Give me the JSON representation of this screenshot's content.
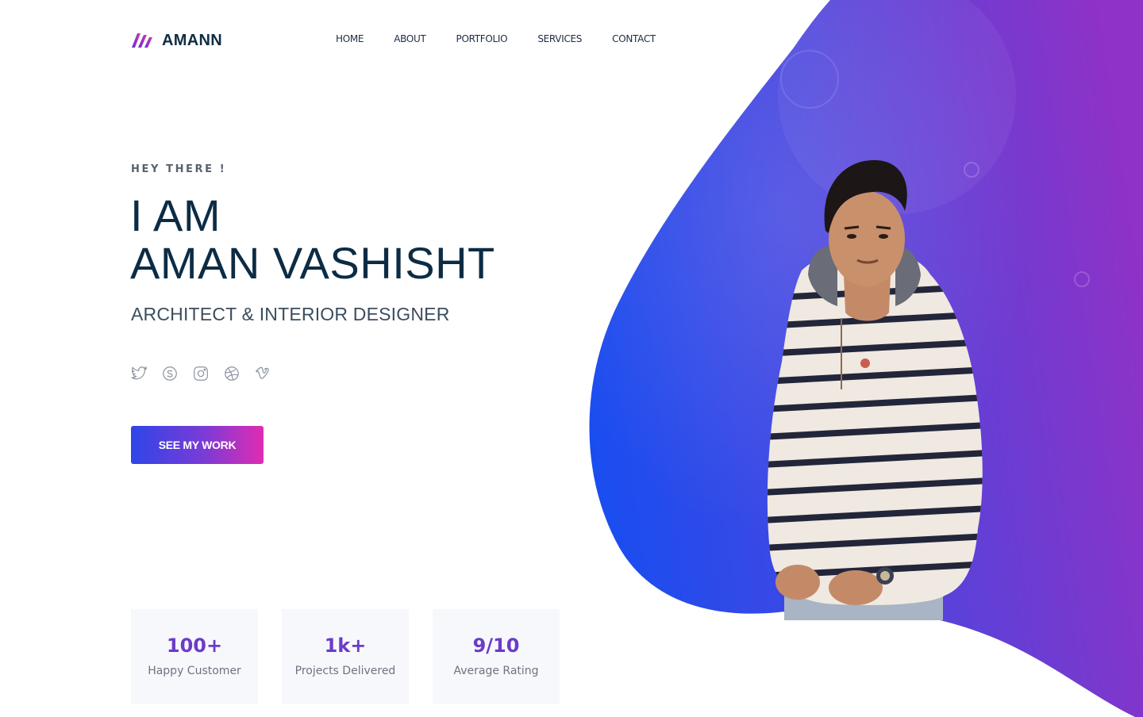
{
  "brand": {
    "name": "AMANN",
    "gradient": [
      "#5b2fe3",
      "#e3359f"
    ]
  },
  "nav": [
    {
      "label": "HOME"
    },
    {
      "label": "ABOUT"
    },
    {
      "label": "PORTFOLIO"
    },
    {
      "label": "SERVICES"
    },
    {
      "label": "CONTACT"
    }
  ],
  "hero": {
    "eyebrow": "HEY THERE !",
    "title_line1": "I AM",
    "title_line2": "AMAN VASHISHT",
    "subtitle": "ARCHITECT & INTERIOR DESIGNER",
    "cta": "SEE MY WORK",
    "blob_colors": [
      "#1f4fe8",
      "#8a35c8"
    ]
  },
  "socials": [
    {
      "icon": "twitter-icon"
    },
    {
      "icon": "skype-icon"
    },
    {
      "icon": "instagram-icon"
    },
    {
      "icon": "dribbble-icon"
    },
    {
      "icon": "vimeo-icon"
    }
  ],
  "stats": [
    {
      "value": "100+",
      "label": "Happy Customer"
    },
    {
      "value": "1k+",
      "label": "Projects Delivered"
    },
    {
      "value": "9/10",
      "label": "Average Rating"
    }
  ]
}
